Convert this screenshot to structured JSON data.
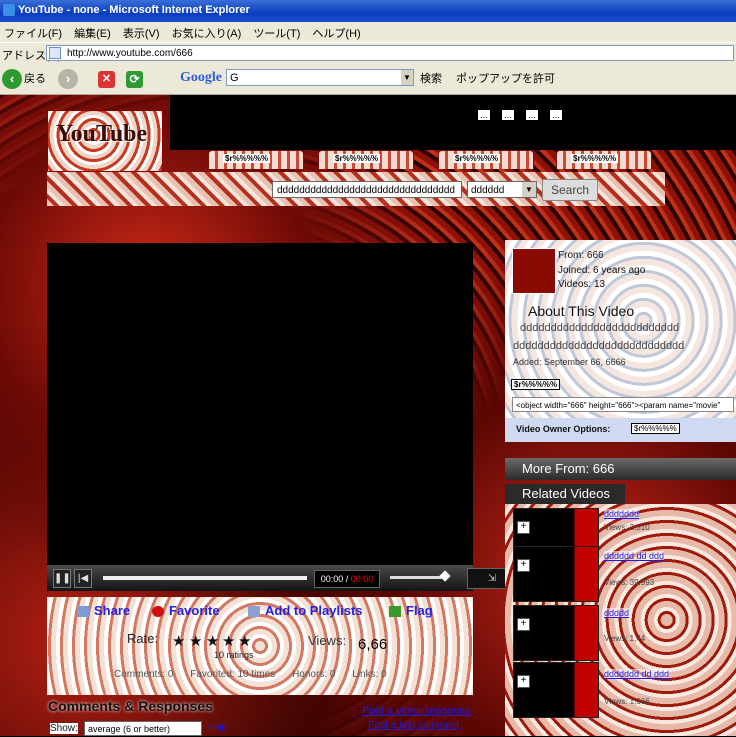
{
  "window": {
    "title": "YouTube - none - Microsoft Internet Explorer"
  },
  "menu": [
    "ファイル(F)",
    "編集(E)",
    "表示(V)",
    "お気に入り(A)",
    "ツール(T)",
    "ヘルプ(H)"
  ],
  "address": {
    "label": "アドレス(D)",
    "url": "http://www.youtube.com/666"
  },
  "toolbar": {
    "back_label": "戻る",
    "google_label": "Google",
    "google_box": "G",
    "search_label": "検索",
    "popup_label": "ポップアップを許可"
  },
  "site": {
    "logo_text": "YouTube",
    "top_links": [
      "...",
      "...",
      "...",
      "..."
    ],
    "tabs": [
      "$r%%%%%",
      "$r%%%%%",
      "$r%%%%%",
      "$r%%%%%"
    ]
  },
  "search": {
    "query": "dddddddddddddddddddddddddddddddd",
    "category": "dddddd",
    "button": "Search"
  },
  "player": {
    "time_current": "00:00",
    "time_sep": " / ",
    "time_total": "00:00",
    "fullscreen": "⇲"
  },
  "actions": {
    "share": "Share",
    "favorite": "Favorite",
    "playlists": "Add to Playlists",
    "flag": "Flag",
    "rate_label": "Rate:",
    "ratings_count": "10 ratings",
    "views_label": "Views:",
    "views_value": "6,66",
    "stats": [
      "Comments: 0",
      "Favorited: 10 times",
      "Honors: 0",
      "Links: 0"
    ]
  },
  "comments": {
    "header": "Comments & Responses",
    "show_label": "Show:",
    "show_value": "average (6 or better)",
    "help": "Help",
    "post_response": "Post a video response",
    "post_comment": "Post a text comment"
  },
  "profile": {
    "from": "From: 666",
    "joined": "Joined: 6 years ago",
    "videos": "Videos: 13",
    "about_header": "About This Video",
    "desc_line1": "dddddddddddddddddddddddddd",
    "desc_line2": "dddddddddddddddddddddddddddd",
    "added": "Added: September 66, 6666",
    "url_badge": "$r%%%%%",
    "embed": "<object width=\"666\" height=\"666\"><param name=\"movie\"",
    "owner_label": "Video Owner Options:",
    "owner_badge": "$r%%%%%"
  },
  "more_from": "More From: 666",
  "related_header": "Related Videos",
  "related": [
    {
      "title": "ddddddd",
      "meta": "Views: 3,310"
    },
    {
      "title": "dddddd dd ddd",
      "meta": "Views: 39,993"
    },
    {
      "title": "ddddd",
      "meta": "Views: 1,44"
    },
    {
      "title": "ddddddd dd ddd",
      "meta": "Views: 1,666"
    }
  ]
}
